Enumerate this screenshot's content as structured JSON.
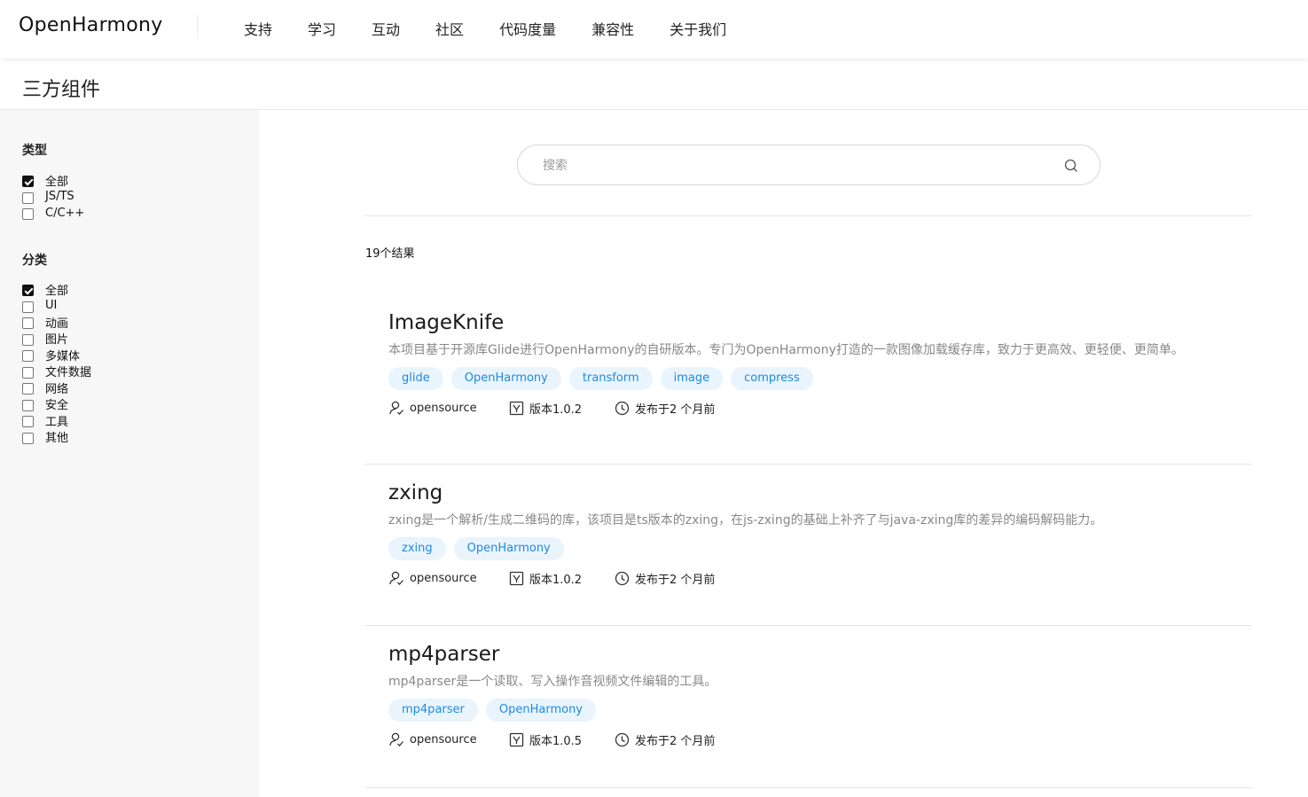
{
  "header": {
    "logo": "OpenHarmony",
    "nav": [
      "支持",
      "学习",
      "互动",
      "社区",
      "代码度量",
      "兼容性",
      "关于我们"
    ]
  },
  "page_title": "三方组件",
  "sidebar": {
    "type": {
      "title": "类型",
      "options": [
        {
          "label": "全部",
          "checked": true
        },
        {
          "label": "JS/TS",
          "checked": false
        },
        {
          "label": "C/C++",
          "checked": false
        }
      ]
    },
    "category": {
      "title": "分类",
      "options": [
        {
          "label": "全部",
          "checked": true
        },
        {
          "label": "UI",
          "checked": false
        },
        {
          "label": "动画",
          "checked": false
        },
        {
          "label": "图片",
          "checked": false
        },
        {
          "label": "多媒体",
          "checked": false
        },
        {
          "label": "文件数据",
          "checked": false
        },
        {
          "label": "网络",
          "checked": false
        },
        {
          "label": "安全",
          "checked": false
        },
        {
          "label": "工具",
          "checked": false
        },
        {
          "label": "其他",
          "checked": false
        }
      ]
    }
  },
  "search": {
    "placeholder": "搜索",
    "value": ""
  },
  "results": {
    "count_label": "19个结果",
    "items": [
      {
        "title": "ImageKnife",
        "description": "本项目基于开源库Glide进行OpenHarmony的自研版本。专门为OpenHarmony打造的一款图像加载缓存库，致力于更高效、更轻便、更简单。",
        "tags": [
          "glide",
          "OpenHarmony",
          "transform",
          "image",
          "compress"
        ],
        "author": "opensource",
        "version": "版本1.0.2",
        "published": "发布于2 个月前"
      },
      {
        "title": "zxing",
        "description": "zxing是一个解析/生成二维码的库，该项目是ts版本的zxing，在js-zxing的基础上补齐了与java-zxing库的差异的编码解码能力。",
        "tags": [
          "zxing",
          "OpenHarmony"
        ],
        "author": "opensource",
        "version": "版本1.0.2",
        "published": "发布于2 个月前"
      },
      {
        "title": "mp4parser",
        "description": "mp4parser是一个读取、写入操作音视频文件编辑的工具。",
        "tags": [
          "mp4parser",
          "OpenHarmony"
        ],
        "author": "opensource",
        "version": "版本1.0.5",
        "published": "发布于2 个月前"
      }
    ]
  },
  "colors": {
    "accent": "#1f8ae0",
    "tag_bg": "#e9f4fd",
    "sidebar_bg": "#f7f7f7"
  }
}
